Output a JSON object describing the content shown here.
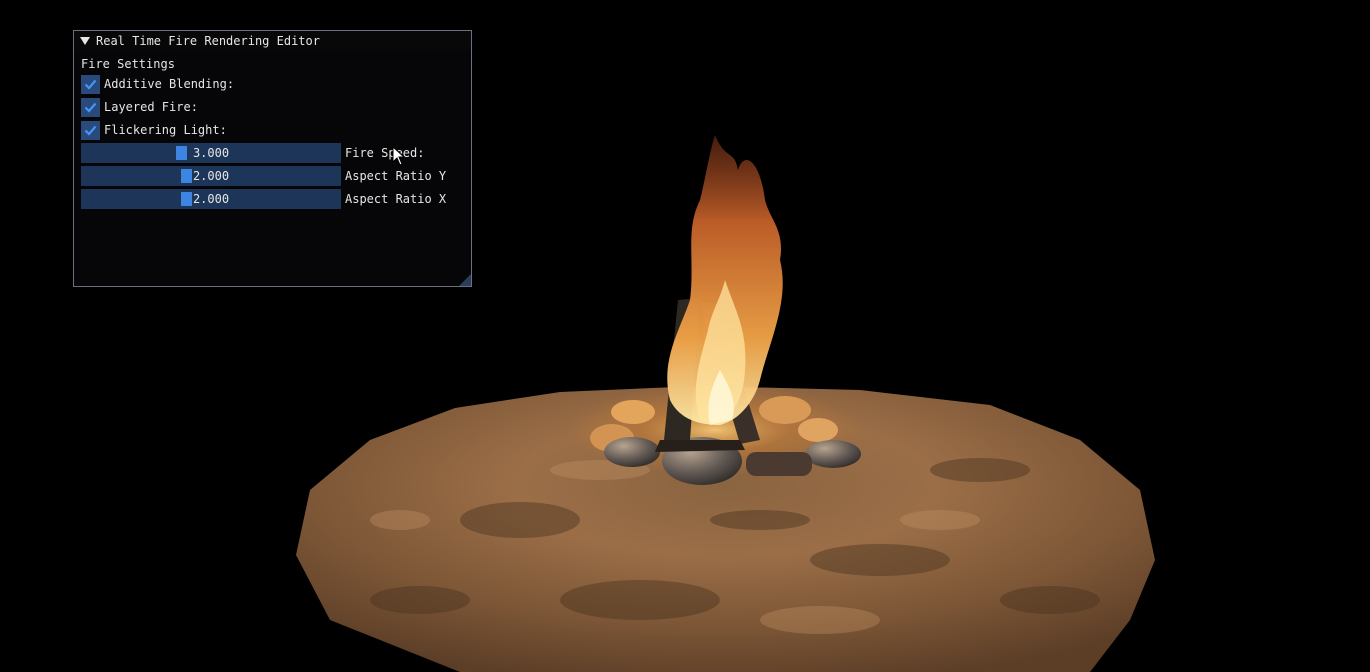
{
  "window": {
    "title": "Real Time Fire Rendering Editor",
    "icons": {
      "collapse": "collapse-triangle-icon",
      "check": "checkmark-icon",
      "cursor": "mouse-pointer-icon"
    }
  },
  "fire_settings": {
    "section_label": "Fire Settings",
    "checkboxes": [
      {
        "label": "Additive Blending:",
        "checked": true
      },
      {
        "label": "Layered Fire:",
        "checked": true
      },
      {
        "label": "Flickering Light:",
        "checked": true
      }
    ],
    "sliders": [
      {
        "label": "Fire Speed:",
        "value": "3.000",
        "fraction": 0.38
      },
      {
        "label": "Aspect Ratio Y",
        "value": "2.000",
        "fraction": 0.4
      },
      {
        "label": "Aspect Ratio X",
        "value": "2.000",
        "fraction": 0.4
      }
    ]
  },
  "colors": {
    "window_bg": "#060608",
    "frame_bg": "#1d3558",
    "slider_grab": "#3d85e0",
    "check_mark": "#4296fa",
    "text": "#e6e6e6"
  }
}
